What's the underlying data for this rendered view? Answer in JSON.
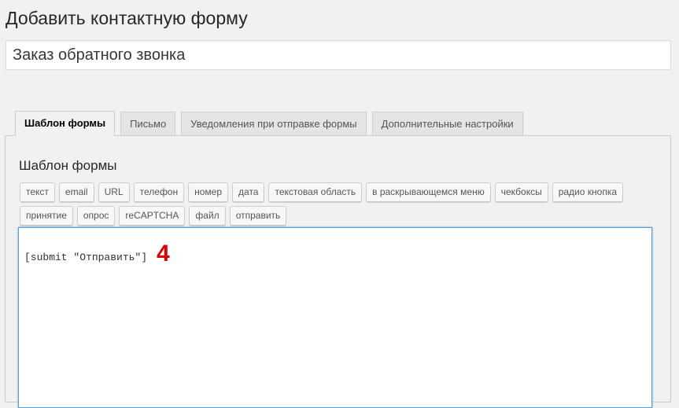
{
  "page": {
    "title": "Добавить контактную форму"
  },
  "form": {
    "title_value": "Заказ обратного звонка"
  },
  "tabs": [
    {
      "label": "Шаблон формы",
      "active": true
    },
    {
      "label": "Письмо",
      "active": false
    },
    {
      "label": "Уведомления при отправке формы",
      "active": false
    },
    {
      "label": "Дополнительные настройки",
      "active": false
    }
  ],
  "panel": {
    "heading": "Шаблон формы",
    "tag_buttons_row1": [
      "текст",
      "email",
      "URL",
      "телефон",
      "номер",
      "дата",
      "текстовая область",
      "в раскрывающемся меню",
      "чекбоксы",
      "радио кнопка"
    ],
    "tag_buttons_row2": [
      "принятие",
      "опрос",
      "reCAPTCHA",
      "файл",
      "отправить"
    ],
    "editor_content": "[submit \"Отправить\"]",
    "annotation": "4"
  },
  "colors": {
    "annotation": "#e00000",
    "editor_focus_border": "#5b9dd9",
    "background": "#f1f1f1"
  }
}
